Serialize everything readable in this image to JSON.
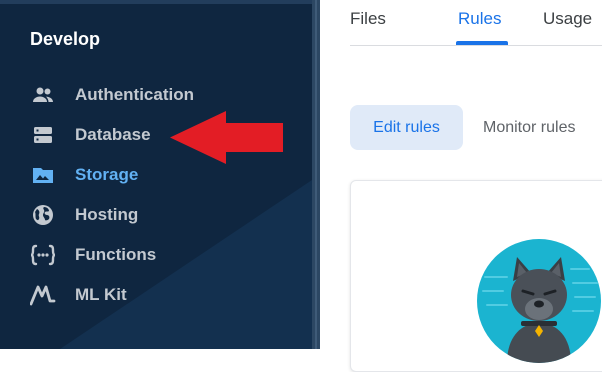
{
  "sidebar": {
    "section_title": "Develop",
    "items": [
      {
        "label": "Authentication",
        "icon": "people-icon",
        "active": false
      },
      {
        "label": "Database",
        "icon": "database-icon",
        "active": false
      },
      {
        "label": "Storage",
        "icon": "storage-folder-icon",
        "active": true
      },
      {
        "label": "Hosting",
        "icon": "globe-icon",
        "active": false
      },
      {
        "label": "Functions",
        "icon": "functions-icon",
        "active": false
      },
      {
        "label": "ML Kit",
        "icon": "ml-kit-icon",
        "active": false
      }
    ]
  },
  "main": {
    "tabs": [
      {
        "label": "Files",
        "active": false
      },
      {
        "label": "Rules",
        "active": true
      },
      {
        "label": "Usage",
        "active": false
      }
    ],
    "edit_rules_label": "Edit rules",
    "monitor_rules_label": "Monitor rules"
  },
  "colors": {
    "sidebar_bg": "#0f2640",
    "active_item": "#62b1f3",
    "accent": "#1a73e8",
    "arrow": "#e31d25",
    "mascot_bg": "#1bb4d0"
  }
}
